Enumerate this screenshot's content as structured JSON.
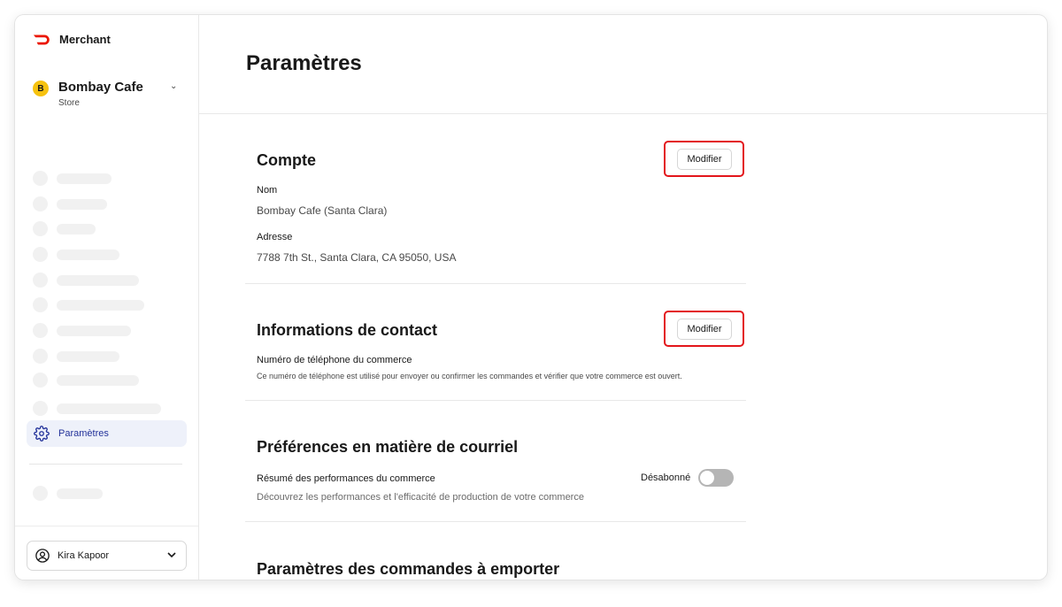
{
  "app": {
    "brand_name": "Merchant",
    "brand_color": "#eb1700"
  },
  "store": {
    "badge": "B",
    "name": "Bombay Cafe",
    "type": "Store"
  },
  "sidebar": {
    "active_item": {
      "label": "Paramètres",
      "icon": "gear-icon"
    }
  },
  "user": {
    "name": "Kira Kapoor"
  },
  "page": {
    "title": "Paramètres"
  },
  "sections": {
    "account": {
      "title": "Compte",
      "edit_label": "Modifier",
      "name_label": "Nom",
      "name_value": "Bombay Cafe (Santa Clara)",
      "address_label": "Adresse",
      "address_value": "7788 7th St., Santa Clara, CA 95050, USA"
    },
    "contact": {
      "title": "Informations de contact",
      "edit_label": "Modifier",
      "phone_label": "Numéro de téléphone du commerce",
      "phone_help": "Ce numéro de téléphone est utilisé pour envoyer ou confirmer les commandes et vérifier que votre commerce est ouvert."
    },
    "email": {
      "title": "Préférences en matière de courriel",
      "summary_label": "Résumé des performances du commerce",
      "summary_help": "Découvrez les performances et l'efficacité de production de votre commerce",
      "toggle_label": "Désabonné",
      "toggle_on": false
    },
    "pickup": {
      "title": "Paramètres des commandes à emporter"
    }
  },
  "colors": {
    "highlight": "#e3161b",
    "active_nav_bg": "#eef1fa",
    "active_nav_text": "#23329a"
  }
}
